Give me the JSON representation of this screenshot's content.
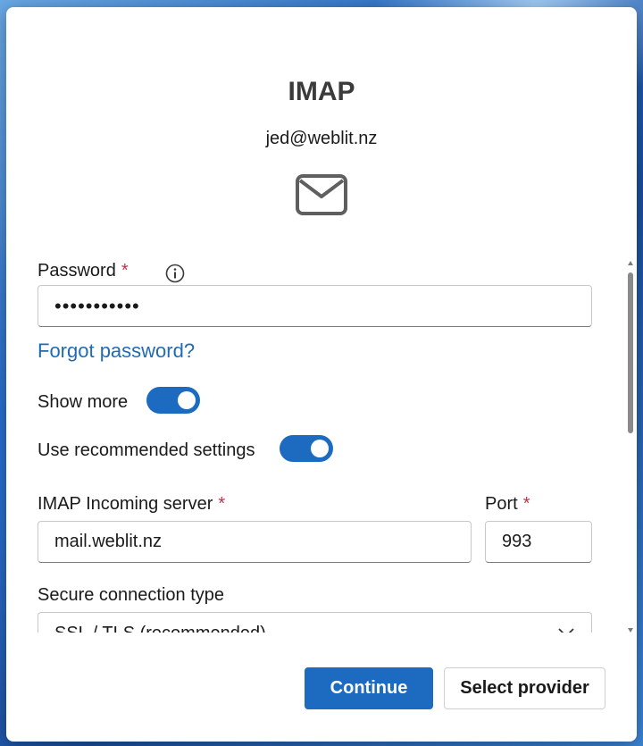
{
  "dialog": {
    "title": "IMAP",
    "email": "jed@weblit.nz"
  },
  "form": {
    "password": {
      "label": "Password",
      "required_mark": "*",
      "value": "•••••••••••"
    },
    "forgot_password": "Forgot password?",
    "show_more": {
      "label": "Show more",
      "on": true
    },
    "recommended": {
      "label": "Use recommended settings",
      "on": true
    },
    "incoming_server": {
      "label": "IMAP Incoming server",
      "required_mark": "*",
      "value": "mail.weblit.nz"
    },
    "port": {
      "label": "Port",
      "required_mark": "*",
      "value": "993"
    },
    "secure_connection": {
      "label": "Secure connection type",
      "value": "SSL / TLS (recommended)"
    }
  },
  "buttons": {
    "continue": "Continue",
    "select_provider": "Select provider"
  },
  "colors": {
    "accent": "#1c6bc0",
    "link": "#1f6bb5",
    "required": "#c4314b"
  },
  "icons": {
    "mail": "mail-icon",
    "info": "info-icon",
    "dropdown": "chevron-down-icon"
  }
}
